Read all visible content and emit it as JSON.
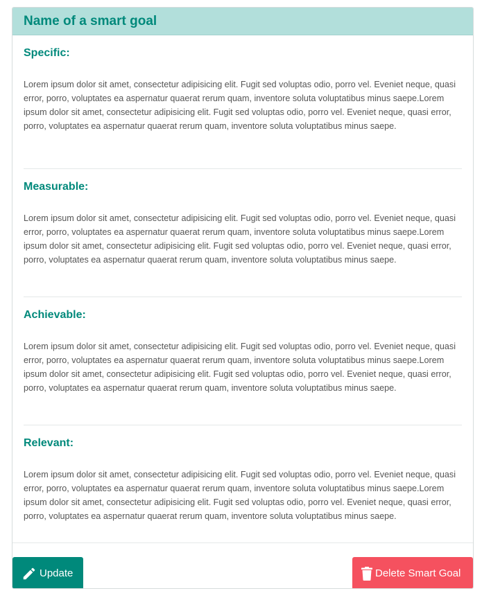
{
  "card": {
    "title": "Name of a smart goal"
  },
  "sections": [
    {
      "title": "Specific:",
      "text": "Lorem ipsum dolor sit amet, consectetur adipisicing elit. Fugit sed voluptas odio, porro vel. Eveniet neque, quasi error, porro, voluptates ea aspernatur quaerat rerum quam, inventore soluta voluptatibus minus saepe.Lorem ipsum dolor sit amet, consectetur adipisicing elit. Fugit sed voluptas odio, porro vel. Eveniet neque, quasi error, porro, voluptates ea aspernatur quaerat rerum quam, inventore soluta voluptatibus minus saepe."
    },
    {
      "title": "Measurable:",
      "text": "Lorem ipsum dolor sit amet, consectetur adipisicing elit. Fugit sed voluptas odio, porro vel. Eveniet neque, quasi error, porro, voluptates ea aspernatur quaerat rerum quam, inventore soluta voluptatibus minus saepe.Lorem ipsum dolor sit amet, consectetur adipisicing elit. Fugit sed voluptas odio, porro vel. Eveniet neque, quasi error, porro, voluptates ea aspernatur quaerat rerum quam, inventore soluta voluptatibus minus saepe."
    },
    {
      "title": "Achievable:",
      "text": "Lorem ipsum dolor sit amet, consectetur adipisicing elit. Fugit sed voluptas odio, porro vel. Eveniet neque, quasi error, porro, voluptates ea aspernatur quaerat rerum quam, inventore soluta voluptatibus minus saepe.Lorem ipsum dolor sit amet, consectetur adipisicing elit. Fugit sed voluptas odio, porro vel. Eveniet neque, quasi error, porro, voluptates ea aspernatur quaerat rerum quam, inventore soluta voluptatibus minus saepe."
    },
    {
      "title": "Relevant:",
      "text": "Lorem ipsum dolor sit amet, consectetur adipisicing elit. Fugit sed voluptas odio, porro vel. Eveniet neque, quasi error, porro, voluptates ea aspernatur quaerat rerum quam, inventore soluta voluptatibus minus saepe.Lorem ipsum dolor sit amet, consectetur adipisicing elit. Fugit sed voluptas odio, porro vel. Eveniet neque, quasi error, porro, voluptates ea aspernatur quaerat rerum quam, inventore soluta voluptatibus minus saepe."
    }
  ],
  "actions": {
    "update_label": "Update",
    "update_icon": "pencil-icon",
    "delete_label": "Delete Smart Goal",
    "delete_icon": "trash-icon"
  },
  "colors": {
    "header_bg": "#b2dfdb",
    "accent": "#00897b",
    "danger": "#f5515f",
    "body_text": "#555555"
  }
}
